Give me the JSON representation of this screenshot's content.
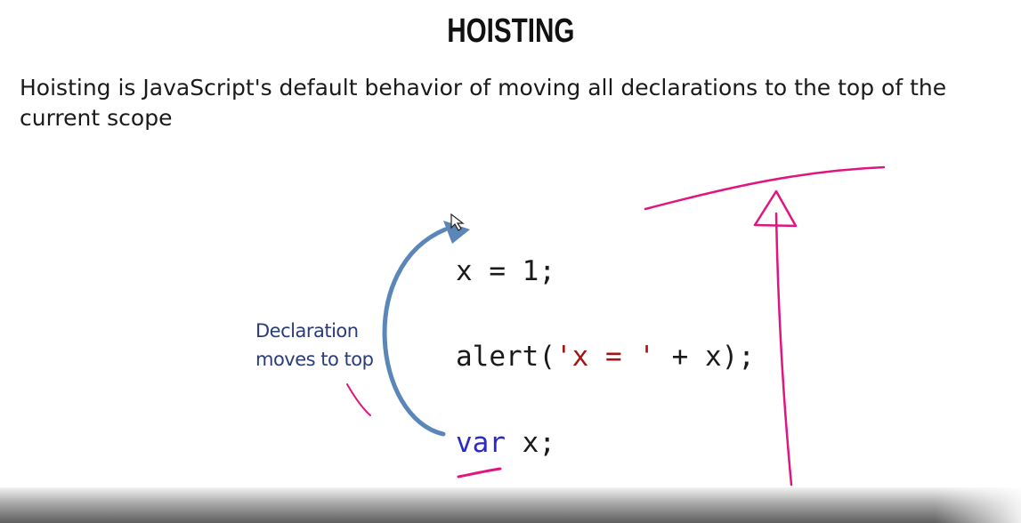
{
  "slide": {
    "title": "HOISTING",
    "description": "Hoisting is JavaScript's default behavior of moving all declarations to the top of the current scope"
  },
  "code": {
    "line1": "x = 1;",
    "line2_func": "alert(",
    "line2_string": "'x = '",
    "line2_rest": " + x);",
    "line3_keyword": "var",
    "line3_rest": " x;"
  },
  "annotation": {
    "line1": "Declaration",
    "line2": "moves to top"
  },
  "colors": {
    "keyword": "#2a2ac8",
    "string": "#a31515",
    "arrow": "#5b86b8",
    "ink": "#e0157f"
  },
  "icons": [
    "curved-arrow-icon",
    "mouse-cursor-icon"
  ]
}
